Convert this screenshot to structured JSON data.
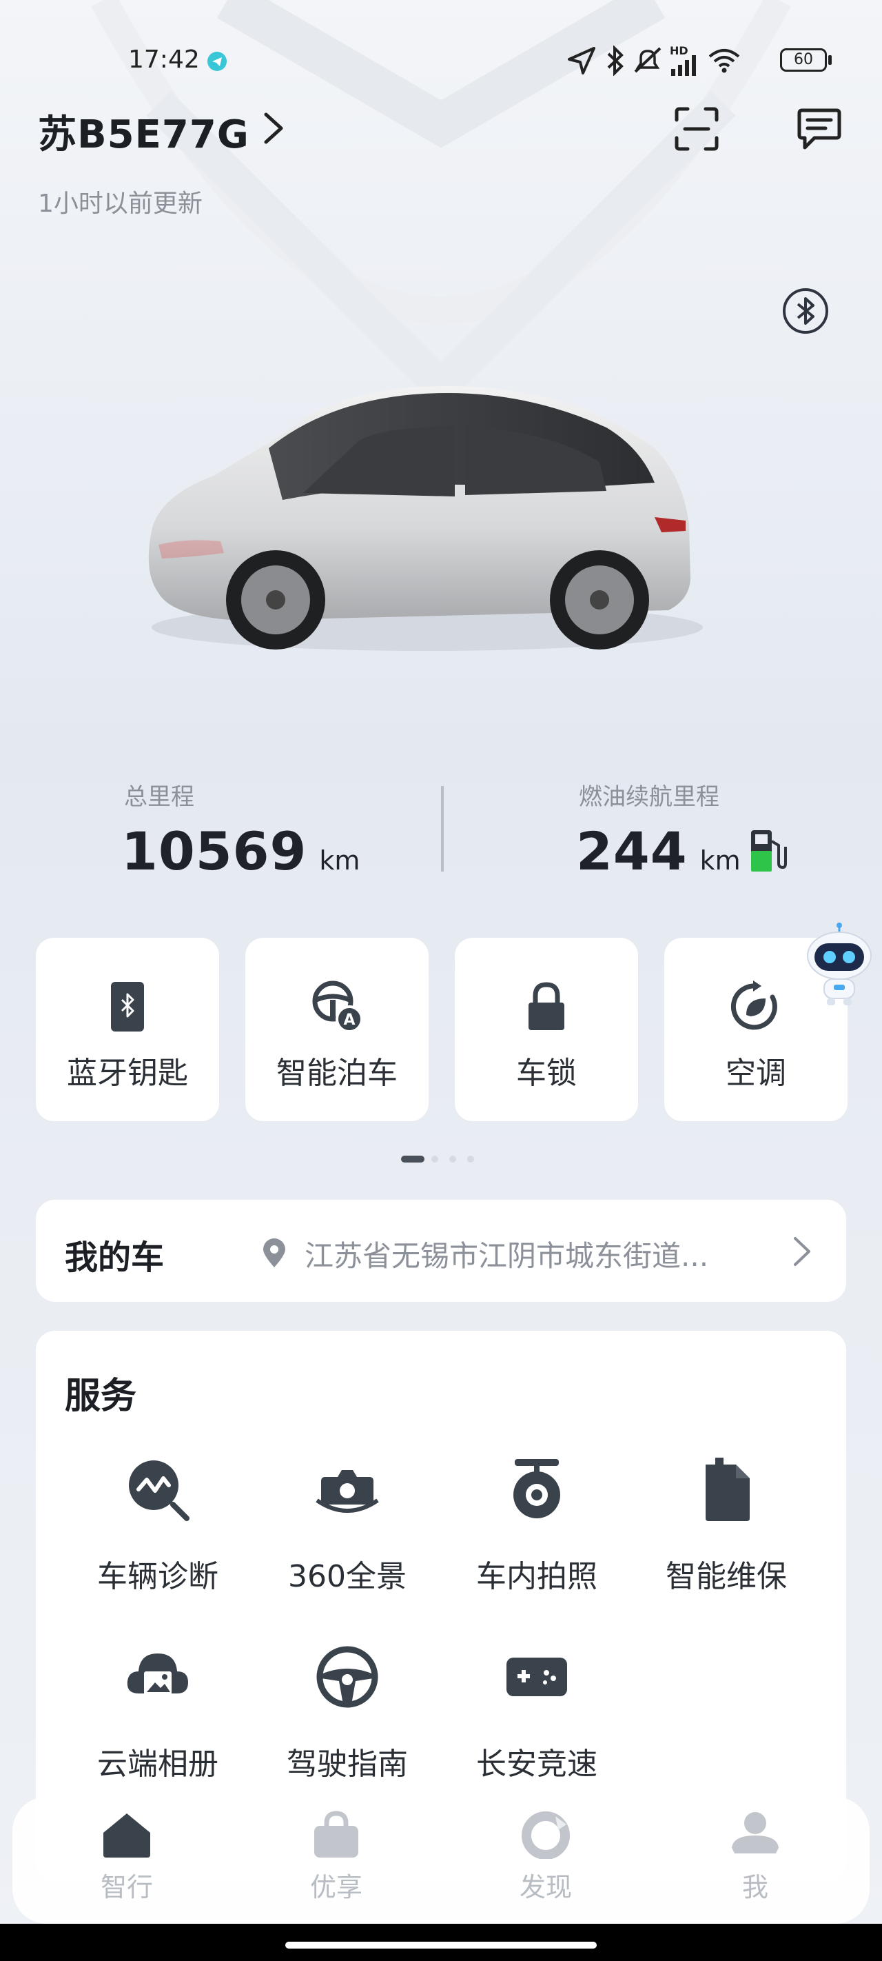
{
  "status_bar": {
    "time": "17:42",
    "hd_label": "HD",
    "battery": "60"
  },
  "header": {
    "plate": "苏B5E77G",
    "updated": "1小时以前更新"
  },
  "stats": {
    "mileage_label": "总里程",
    "mileage_value": "10569",
    "mileage_unit": "km",
    "range_label": "燃油续航里程",
    "range_value": "244",
    "range_unit": "km"
  },
  "quick_actions": [
    {
      "label": "蓝牙钥匙",
      "icon": "bluetooth-key-icon"
    },
    {
      "label": "智能泊车",
      "icon": "auto-parking-icon"
    },
    {
      "label": "车锁",
      "icon": "lock-icon"
    },
    {
      "label": "空调",
      "icon": "air-conditioning-icon"
    }
  ],
  "pager": {
    "pages": 4,
    "active": 1
  },
  "my_car": {
    "title": "我的车",
    "location": "江苏省无锡市江阴市城东街道..."
  },
  "services": {
    "title": "服务",
    "items": [
      {
        "label": "车辆诊断",
        "icon": "diagnosis-icon"
      },
      {
        "label": "360全景",
        "icon": "panorama-camera-icon"
      },
      {
        "label": "车内拍照",
        "icon": "in-car-camera-icon"
      },
      {
        "label": "智能维保",
        "icon": "maintenance-icon"
      },
      {
        "label": "云端相册",
        "icon": "cloud-album-icon"
      },
      {
        "label": "驾驶指南",
        "icon": "steering-wheel-icon"
      },
      {
        "label": "长安竞速",
        "icon": "gamepad-icon"
      }
    ]
  },
  "tabbar": {
    "tabs": [
      {
        "label": "智行",
        "icon": "home-icon",
        "active": true
      },
      {
        "label": "优享",
        "icon": "bag-icon",
        "active": false
      },
      {
        "label": "发现",
        "icon": "discover-icon",
        "active": false
      },
      {
        "label": "我",
        "icon": "person-icon",
        "active": false
      }
    ]
  },
  "colors": {
    "accent_dark": "#3a424c",
    "fuel_green": "#2ec44a",
    "card_bg": "#ffffff",
    "tab_inactive": "#b8bcc3"
  }
}
